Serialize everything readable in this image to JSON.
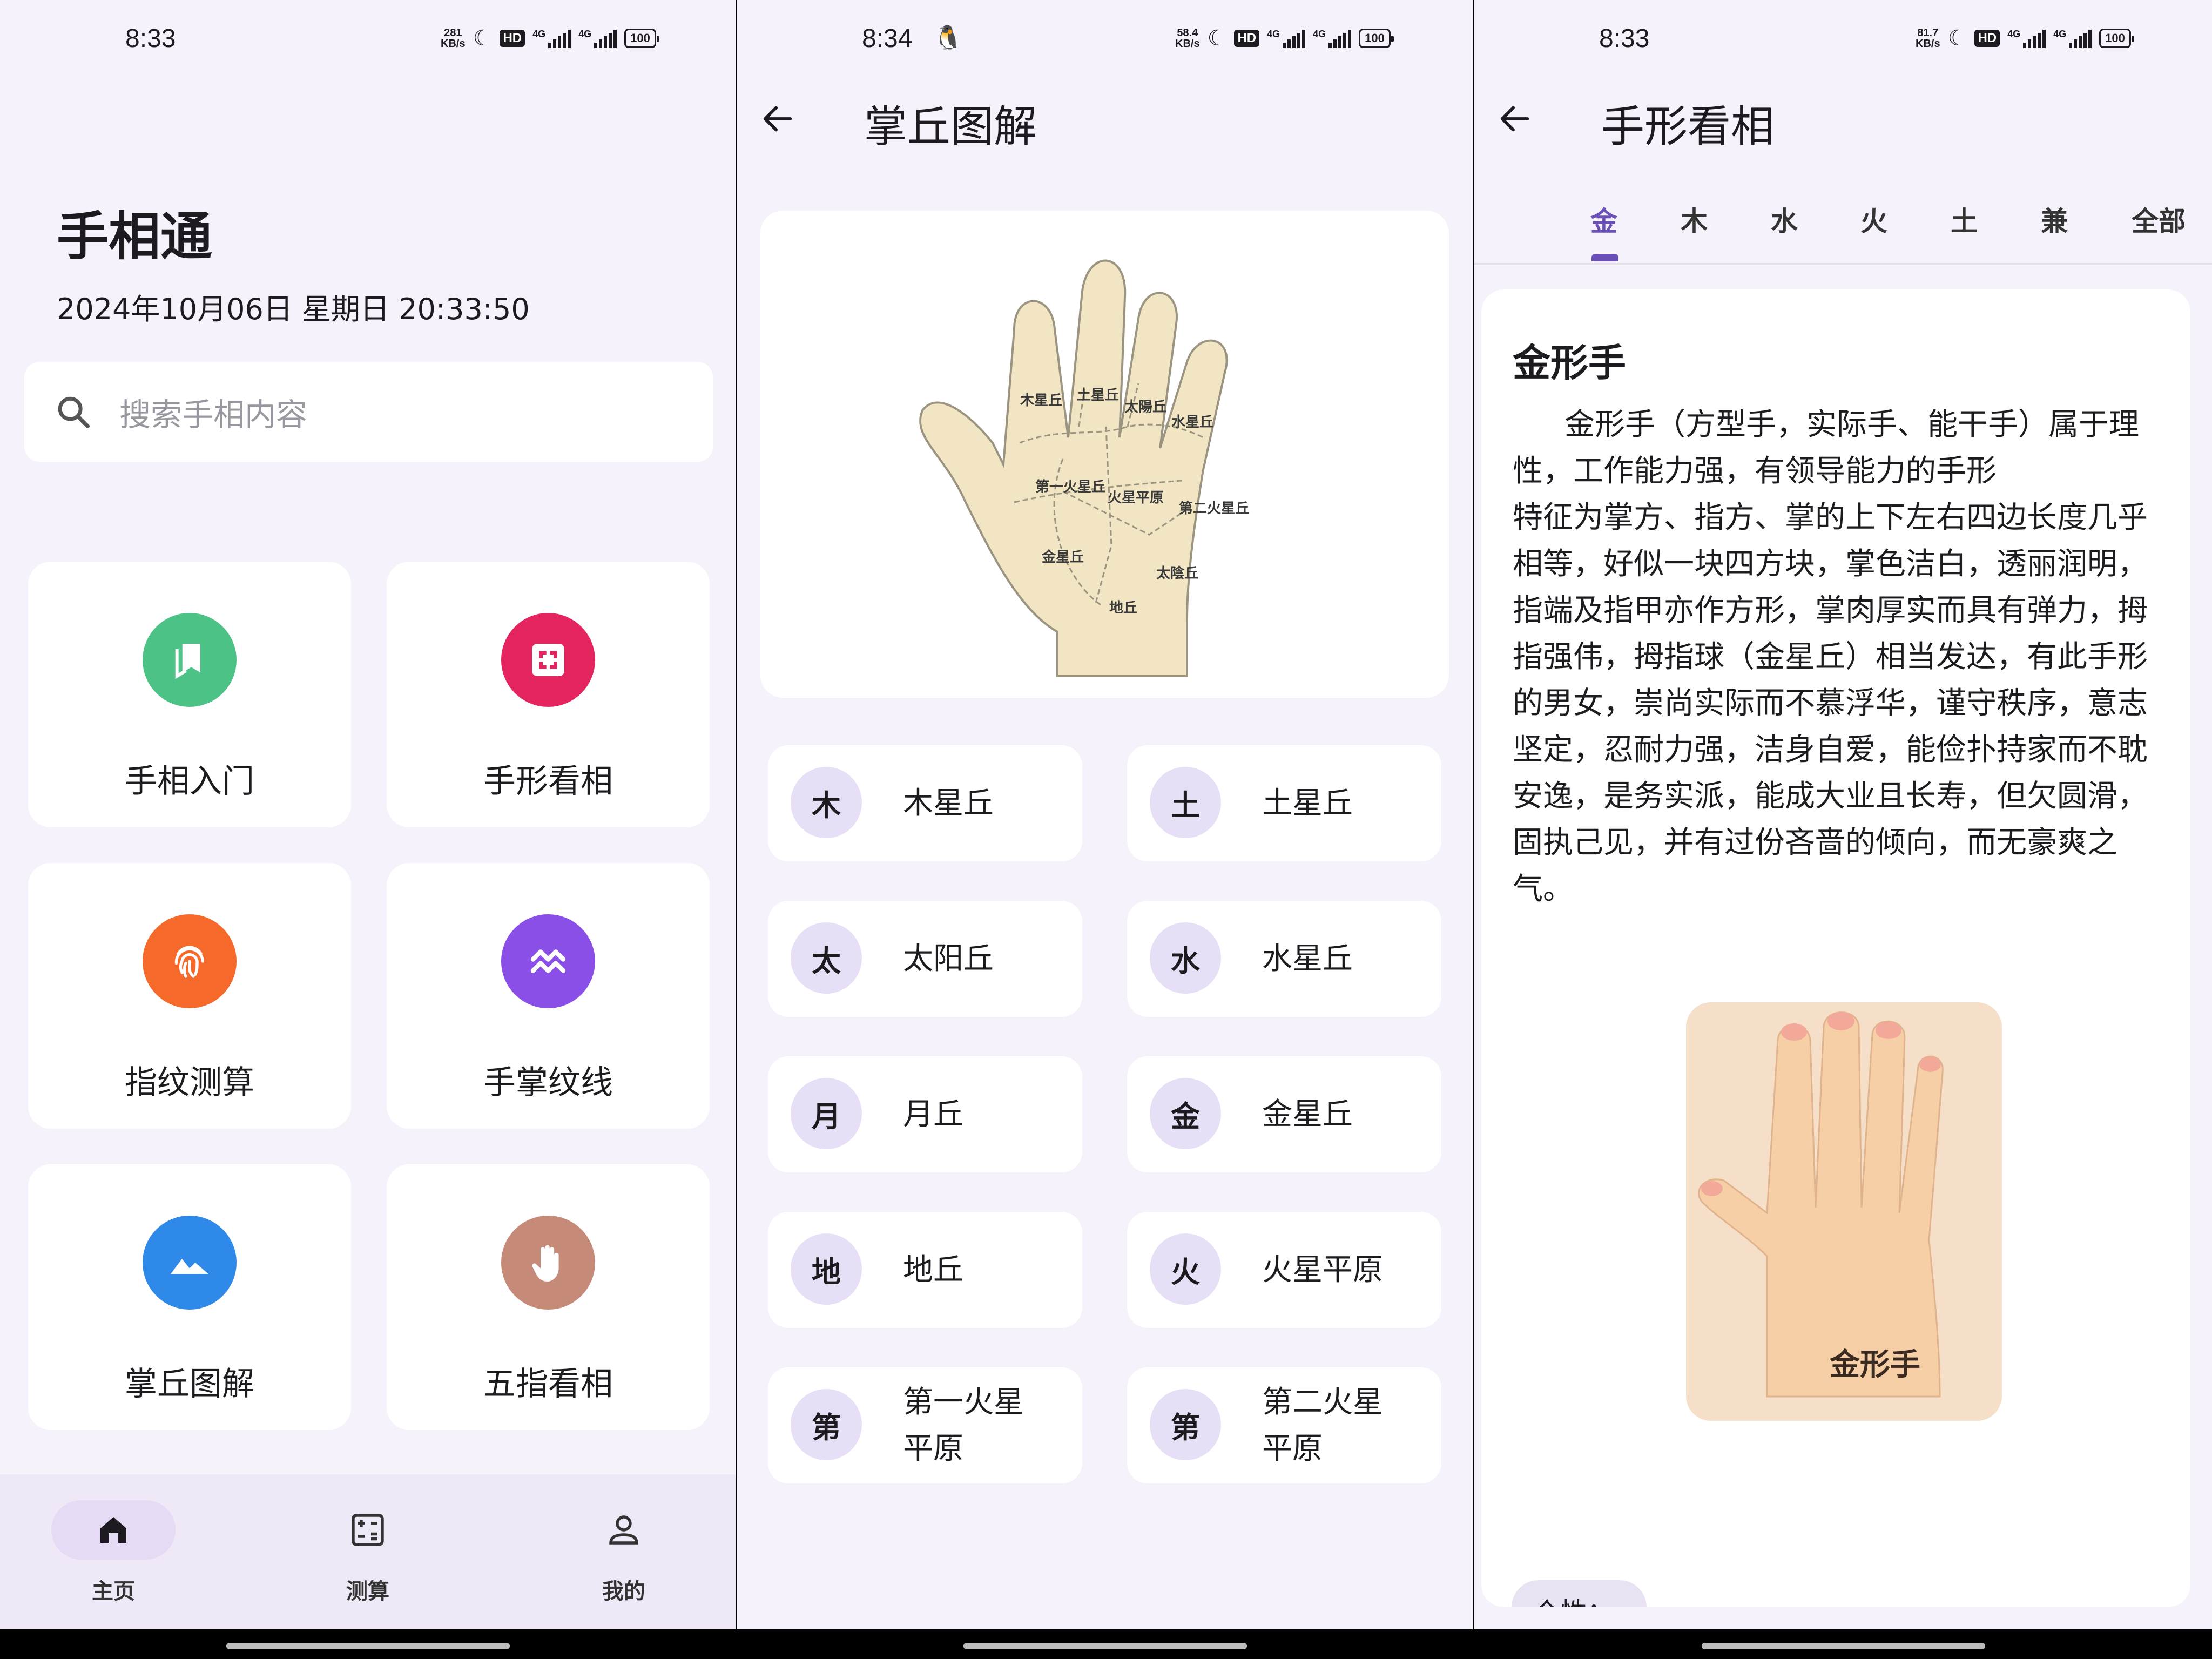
{
  "screen1": {
    "status": {
      "time": "8:33",
      "speed_value": "281",
      "speed_unit": "KB/s",
      "hd": "HD",
      "net1": "4G",
      "net2": "4G",
      "battery": "100"
    },
    "app_title": "手相通",
    "date": "2024年10月06日 星期日   20:33:50",
    "search_placeholder": "搜索手相内容",
    "cards": [
      {
        "label": "手相入门",
        "color": "#4cc286",
        "icon": "bookmark-icon"
      },
      {
        "label": "手形看相",
        "color": "#e3245f",
        "icon": "fullscreen-icon"
      },
      {
        "label": "指纹测算",
        "color": "#f56a2b",
        "icon": "fingerprint-icon"
      },
      {
        "label": "手掌纹线",
        "color": "#8a4fe6",
        "icon": "zigzag-icon"
      },
      {
        "label": "掌丘图解",
        "color": "#2e89e8",
        "icon": "mountain-icon"
      },
      {
        "label": "五指看相",
        "color": "#c58b78",
        "icon": "hand-icon"
      }
    ],
    "nav": [
      {
        "label": "主页",
        "active": true,
        "icon": "home-icon"
      },
      {
        "label": "测算",
        "active": false,
        "icon": "calculator-icon"
      },
      {
        "label": "我的",
        "active": false,
        "icon": "person-icon"
      }
    ]
  },
  "screen2": {
    "status": {
      "time": "8:34",
      "speed_value": "58.4",
      "speed_unit": "KB/s",
      "hd": "HD",
      "net1": "4G",
      "net2": "4G",
      "battery": "100"
    },
    "title": "掌丘图解",
    "diagram_labels": [
      "木星丘",
      "土星丘",
      "太陽丘",
      "水星丘",
      "第一火星丘",
      "火星平原",
      "第二火星丘",
      "金星丘",
      "太陰丘",
      "地丘"
    ],
    "mounts": [
      {
        "avatar": "木",
        "name": "木星丘"
      },
      {
        "avatar": "土",
        "name": "土星丘"
      },
      {
        "avatar": "太",
        "name": "太阳丘"
      },
      {
        "avatar": "水",
        "name": "水星丘"
      },
      {
        "avatar": "月",
        "name": "月丘"
      },
      {
        "avatar": "金",
        "name": "金星丘"
      },
      {
        "avatar": "地",
        "name": "地丘"
      },
      {
        "avatar": "火",
        "name": "火星平原"
      },
      {
        "avatar": "第",
        "name": "第一火星平原"
      },
      {
        "avatar": "第",
        "name": "第二火星平原"
      }
    ]
  },
  "screen3": {
    "status": {
      "time": "8:33",
      "speed_value": "81.7",
      "speed_unit": "KB/s",
      "hd": "HD",
      "net1": "4G",
      "net2": "4G",
      "battery": "100"
    },
    "title": "手形看相",
    "tabs": [
      "金",
      "木",
      "水",
      "火",
      "土",
      "兼",
      "全部"
    ],
    "active_tab": "金",
    "heading": "金形手",
    "para1": "金形手（方型手，实际手、能干手）属于理性，工作能力强，有领导能力的手形",
    "para2": "特征为掌方、指方、掌的上下左右四边长度几乎相等，好似一块四方块，掌色洁白，透丽润明，指端及指甲亦作方形，掌肉厚实而具有弹力，拇指强伟，拇指球（金星丘）相当发达，有此手形的男女，崇尚实际而不慕浮华，谨守秩序，意志坚定，忍耐力强，洁身自爱，能俭扑持家而不耽安逸，是务实派，能成大业且长寿，但欠圆滑，固执己见，并有过份吝啬的倾向，而无豪爽之气。",
    "image_caption": "金形手",
    "chip": "个性："
  }
}
